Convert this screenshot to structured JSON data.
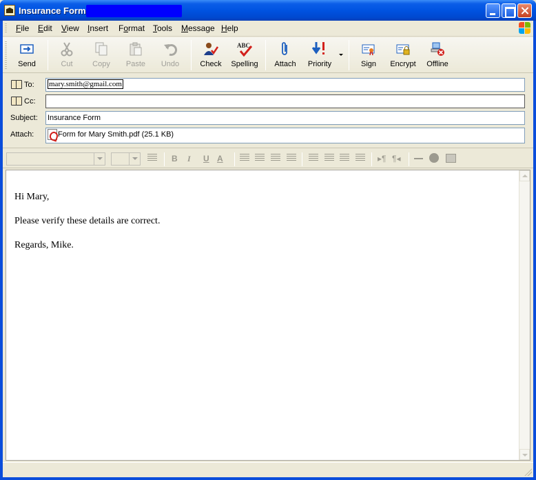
{
  "window": {
    "title": "Insurance Form"
  },
  "menu": [
    {
      "pre": "",
      "key": "F",
      "post": "ile"
    },
    {
      "pre": "",
      "key": "E",
      "post": "dit"
    },
    {
      "pre": "",
      "key": "V",
      "post": "iew"
    },
    {
      "pre": "",
      "key": "I",
      "post": "nsert"
    },
    {
      "pre": "F",
      "key": "o",
      "post": "rmat"
    },
    {
      "pre": "",
      "key": "T",
      "post": "ools"
    },
    {
      "pre": "",
      "key": "M",
      "post": "essage"
    },
    {
      "pre": "",
      "key": "H",
      "post": "elp"
    }
  ],
  "toolbar": {
    "send": "Send",
    "cut": "Cut",
    "copy": "Copy",
    "paste": "Paste",
    "undo": "Undo",
    "check": "Check",
    "spelling": "Spelling",
    "spelling_badge": "ABC",
    "attach": "Attach",
    "priority": "Priority",
    "sign": "Sign",
    "encrypt": "Encrypt",
    "offline": "Offline"
  },
  "fields": {
    "to_label": "To:",
    "to_value": "mary.smith@gmail.com",
    "cc_label": "Cc:",
    "cc_value": "",
    "subject_label": "Subject:",
    "subject_value": "Insurance Form",
    "attach_label": "Attach:",
    "attachment": "Form for Mary Smith.pdf (25.1 KB)"
  },
  "body": {
    "line1": "Hi Mary,",
    "line2": "Please verify these details are correct.",
    "line3": "Regards, Mike."
  },
  "colors": {
    "title_bar": "#0053e1",
    "redaction": "#0000ff",
    "send_blue": "#1d5fbf",
    "priority_red": "#d2201b"
  }
}
